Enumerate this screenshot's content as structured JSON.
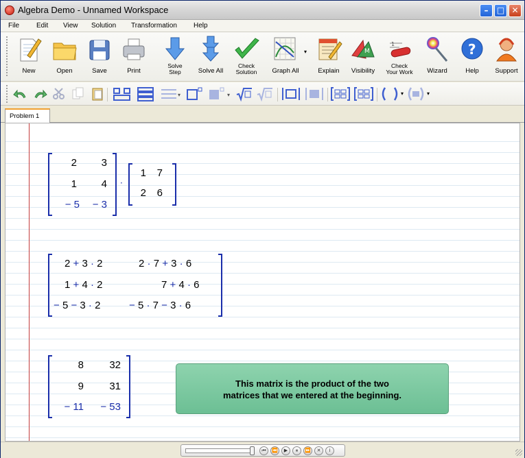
{
  "window": {
    "title": "Algebra Demo - Unnamed Workspace"
  },
  "menu": [
    "File",
    "Edit",
    "View",
    "Solution",
    "Transformation",
    "Help"
  ],
  "toolbar": {
    "new": "New",
    "open": "Open",
    "save": "Save",
    "print": "Print",
    "solve_step_1": "Solve",
    "solve_step_2": "Step",
    "solve_all": "Solve All",
    "check_solution_1": "Check",
    "check_solution_2": "Solution",
    "graph_all": "Graph All",
    "explain": "Explain",
    "visibility": "Visibility",
    "check_work_1": "Check",
    "check_work_2": "Your Work",
    "wizard": "Wizard",
    "help": "Help",
    "support": "Support"
  },
  "tabs": [
    {
      "label": "Problem 1"
    }
  ],
  "matrices": {
    "a": [
      [
        "2",
        "3"
      ],
      [
        "1",
        "4"
      ],
      [
        "− 5",
        "− 3"
      ]
    ],
    "b": [
      [
        "1",
        "7"
      ],
      [
        "2",
        "6"
      ]
    ],
    "expanded": {
      "r1c1_a": "2",
      "r1c1_op1": "+",
      "r1c1_b": "3",
      "r1c1_c": "2",
      "r1c2_a": "2",
      "r1c2_b": "7",
      "r1c2_op": "+",
      "r1c2_c": "3",
      "r1c2_d": "6",
      "r2c1_a": "1",
      "r2c1_op1": "+",
      "r2c1_b": "4",
      "r2c1_c": "2",
      "r2c2_b": "7",
      "r2c2_op": "+",
      "r2c2_c": "4",
      "r2c2_d": "6",
      "r3c1_neg": "−",
      "r3c1_a": "5",
      "r3c1_op1": "−",
      "r3c1_b": "3",
      "r3c1_c": "2",
      "r3c2_neg": "−",
      "r3c2_a": "5",
      "r3c2_b": "7",
      "r3c2_op": "−",
      "r3c2_c": "3",
      "r3c2_d": "6"
    },
    "result": [
      [
        "8",
        "32"
      ],
      [
        "9",
        "31"
      ],
      [
        "− 11",
        "− 53"
      ]
    ]
  },
  "tooltip": {
    "line1": "This matrix is the product of the two",
    "line2": "matrices that we entered at the beginning."
  },
  "colors": {
    "accent_blue": "#1a2eaa",
    "tip_green": "#7cc8a0",
    "margin_red": "#c43c3c",
    "tab_orange": "#f0a030"
  }
}
